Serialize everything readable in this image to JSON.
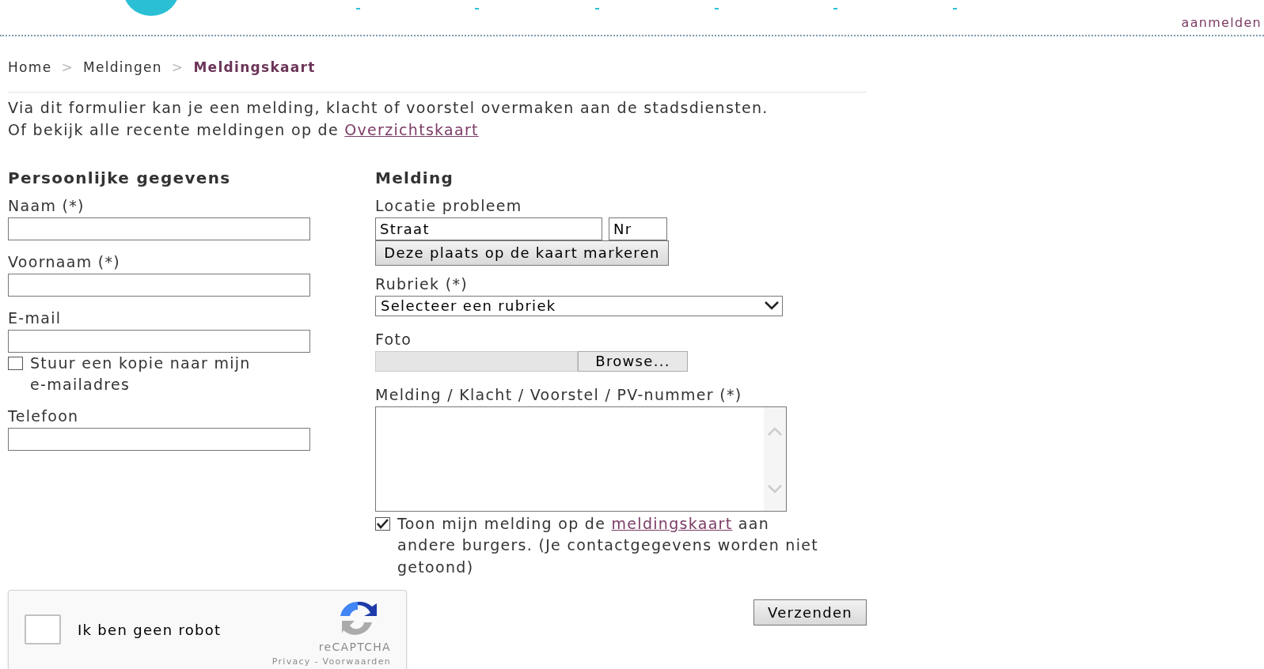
{
  "header": {
    "login_link": "aanmelden"
  },
  "breadcrumb": [
    {
      "label": "Home",
      "selected": false
    },
    {
      "label": "Meldingen",
      "selected": false
    },
    {
      "label": "Meldingskaart",
      "selected": true
    }
  ],
  "breadcrumb_separator": ">",
  "intro": {
    "line_1": "Via dit formulier kan je een melding, klacht of voorstel overmaken aan de stadsdiensten.",
    "line_2_before": "Of bekijk alle recente meldingen op de ",
    "line_2_link": "Overzichtskaart"
  },
  "personal": {
    "title": "Persoonlijke gegevens",
    "fields": [
      {
        "label": "Naam (*)",
        "kind": "text"
      },
      {
        "label": "Voornaam (*)",
        "kind": "text"
      },
      {
        "label": "E-mail",
        "kind": "text"
      },
      {
        "label": "Stuur een kopie naar mijn e-mailadres",
        "kind": "checkbox",
        "checked": false
      },
      {
        "label": "Telefoon",
        "kind": "text"
      }
    ]
  },
  "report": {
    "title": "Melding",
    "location": {
      "label": "Locatie probleem",
      "street_placeholder": "Straat",
      "number_placeholder": "Nr",
      "button": "Deze plaats op de kaart markeren"
    },
    "category": {
      "label": "Rubriek (*)",
      "value": "Selecteer een rubriek"
    },
    "photo": {
      "label": "Foto",
      "button": "Browse..."
    },
    "message": {
      "label": "Melding / Klacht / Voorstel / PV-nummer (*)"
    },
    "show_on_map": {
      "checked": true,
      "before": "Toon mijn melding op de ",
      "link": "meldingskaart",
      "after": " aan andere burgers. (Je contactgegevens worden niet getoond)"
    }
  },
  "captcha": {
    "checked": false,
    "label": "Ik ben geen robot",
    "brand": "reCAPTCHA",
    "links": "Privacy - Voorwaarden"
  },
  "submit": "Verzenden"
}
